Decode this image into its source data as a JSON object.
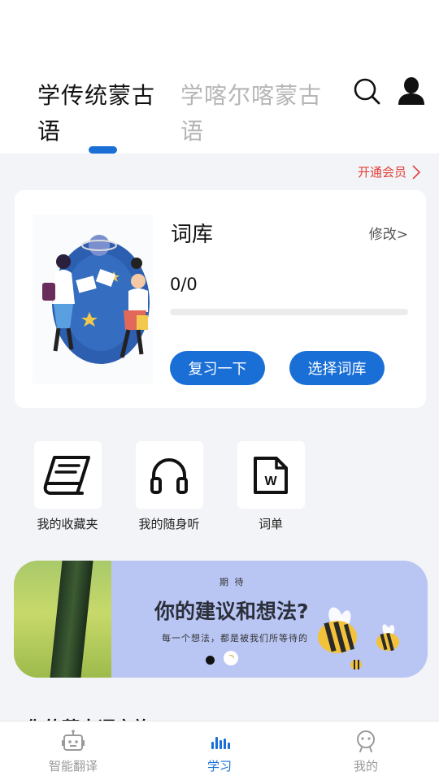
{
  "tabs": [
    {
      "label": "学传统蒙古语",
      "active": true
    },
    {
      "label": "学喀尔喀蒙古语",
      "active": false
    }
  ],
  "header_icons": [
    "search-icon",
    "user-icon"
  ],
  "vip": {
    "label": "开通会员"
  },
  "card": {
    "title": "词库",
    "edit_label": "修改>",
    "progress_text": "0/0",
    "progress_fraction": 0,
    "review_button": "复习一下",
    "choose_button": "选择词库"
  },
  "shortcuts": [
    {
      "label": "我的收藏夹",
      "icon": "book-icon"
    },
    {
      "label": "我的随身听",
      "icon": "headphones-icon"
    },
    {
      "label": "词单",
      "icon": "word-document-icon"
    }
  ],
  "banner": {
    "subtitle": "期 待",
    "title": "你的建议和想法?",
    "description": "每一个想法，都是被我们所等待的",
    "slide_count": 2,
    "active_slide": 0
  },
  "section": {
    "title": "你的蒙古语之旅"
  },
  "bottom_nav": [
    {
      "label": "智能翻译",
      "icon": "robot-icon",
      "active": false
    },
    {
      "label": "学习",
      "icon": "bars-icon",
      "active": true
    },
    {
      "label": "我的",
      "icon": "profile-icon",
      "active": false
    }
  ],
  "colors": {
    "accent": "#1a6fd6",
    "vip": "#e0403a",
    "inactive_tab": "#b5b5b5",
    "background": "#f3f4f7",
    "banner": "#b9c6f3"
  }
}
